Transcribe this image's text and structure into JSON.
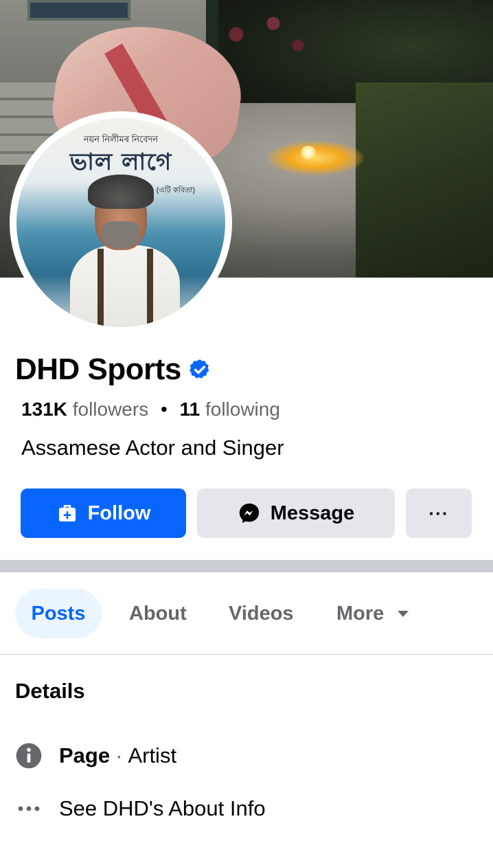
{
  "profile": {
    "name": "DHD Sports",
    "followers_count": "131K",
    "followers_label": "followers",
    "following_count": "11",
    "following_label": "following",
    "bio": "Assamese Actor and Singer",
    "verified": true
  },
  "avatar": {
    "line1": "নয়ন নিলীমৰ নিবেদন",
    "title": "ভাল লাগে",
    "subtitle": "(এটি কবিতা)"
  },
  "actions": {
    "follow_label": "Follow",
    "message_label": "Message",
    "more_label": "···"
  },
  "tabs": [
    {
      "label": "Posts",
      "active": true
    },
    {
      "label": "About",
      "active": false
    },
    {
      "label": "Videos",
      "active": false
    },
    {
      "label": "More",
      "active": false
    }
  ],
  "details": {
    "title": "Details",
    "page_label": "Page",
    "page_category": "Artist",
    "about_link": "See DHD's About Info"
  },
  "colors": {
    "primary": "#0866ff",
    "secondary_bg": "#e4e6eb",
    "muted_text": "#65676b",
    "active_tab_bg": "#ebf5ff"
  },
  "icons": {
    "verified": "verified-badge-icon",
    "follow": "follow-icon",
    "message": "messenger-icon",
    "more": "more-dots-icon",
    "dropdown": "caret-down-icon",
    "info": "info-icon",
    "about": "ellipsis-icon"
  }
}
